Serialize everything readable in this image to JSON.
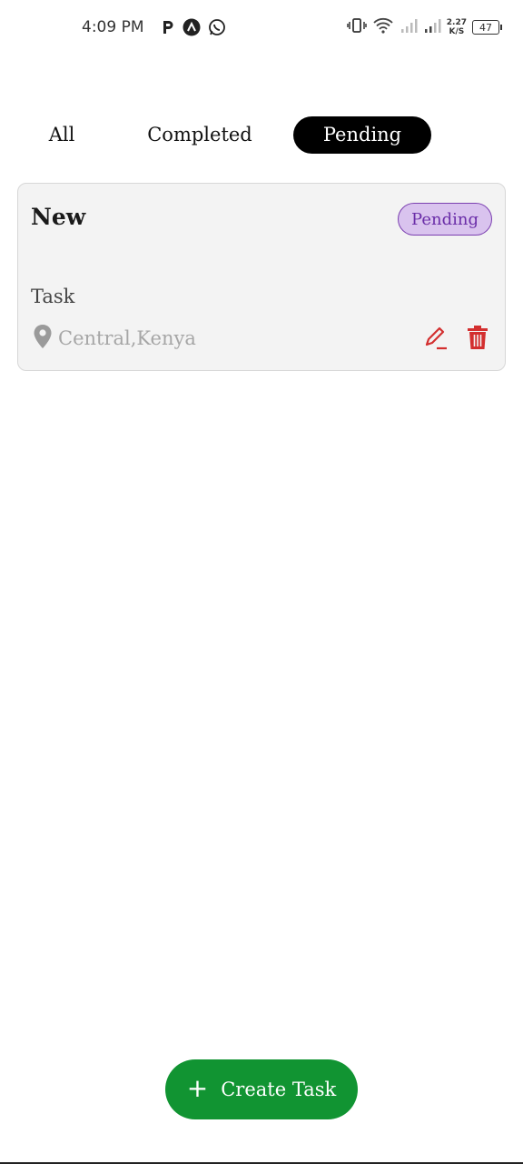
{
  "status_bar": {
    "time": "4:09 PM",
    "net_speed_value": "2.27",
    "net_speed_unit": "K/S",
    "battery": "47"
  },
  "tabs": [
    {
      "label": "All",
      "active": false
    },
    {
      "label": "Completed",
      "active": false
    },
    {
      "label": "Pending",
      "active": true
    }
  ],
  "tasks": [
    {
      "title": "New",
      "status": "Pending",
      "description": "Task",
      "location": "Central,Kenya"
    }
  ],
  "fab": {
    "label": "Create Task",
    "icon": "plus-icon"
  },
  "colors": {
    "active_tab_bg": "#000000",
    "badge_bg": "#d9c3ee",
    "badge_text": "#6a2da8",
    "action_icons": "#d32f2f",
    "fab_bg": "#119432"
  }
}
